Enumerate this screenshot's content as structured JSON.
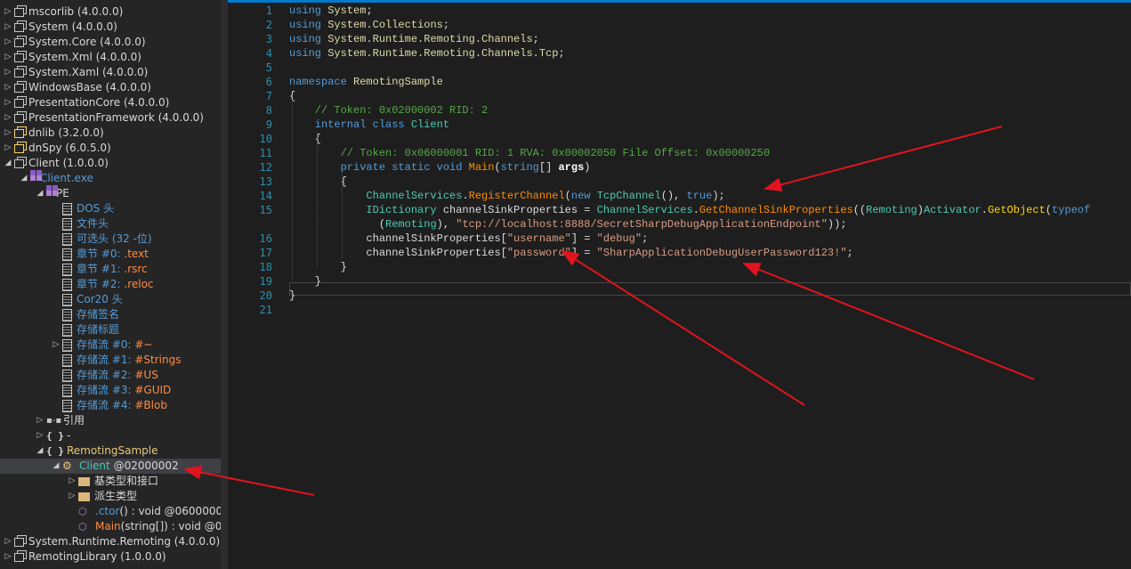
{
  "tree": {
    "nodes": [
      {
        "depth": 0,
        "tw": "▷",
        "icon": "asm",
        "name": "mscorlib",
        "extra": " (4.0.0.0)",
        "nc": "def"
      },
      {
        "depth": 0,
        "tw": "▷",
        "icon": "asm",
        "name": "System",
        "extra": " (4.0.0.0)",
        "nc": "def"
      },
      {
        "depth": 0,
        "tw": "▷",
        "icon": "asm",
        "name": "System.Core",
        "extra": " (4.0.0.0)",
        "nc": "def"
      },
      {
        "depth": 0,
        "tw": "▷",
        "icon": "asm",
        "name": "System.Xml",
        "extra": " (4.0.0.0)",
        "nc": "def"
      },
      {
        "depth": 0,
        "tw": "▷",
        "icon": "asm",
        "name": "System.Xaml",
        "extra": " (4.0.0.0)",
        "nc": "def"
      },
      {
        "depth": 0,
        "tw": "▷",
        "icon": "asm",
        "name": "WindowsBase",
        "extra": " (4.0.0.0)",
        "nc": "def"
      },
      {
        "depth": 0,
        "tw": "▷",
        "icon": "asm",
        "name": "PresentationCore",
        "extra": " (4.0.0.0)",
        "nc": "def"
      },
      {
        "depth": 0,
        "tw": "▷",
        "icon": "asm",
        "name": "PresentationFramework",
        "extra": " (4.0.0.0)",
        "nc": "def"
      },
      {
        "depth": 0,
        "tw": "▷",
        "icon": "asmj",
        "name": "dnlib",
        "extra": " (3.2.0.0)",
        "nc": "def"
      },
      {
        "depth": 0,
        "tw": "▷",
        "icon": "asmj",
        "name": "dnSpy",
        "extra": " (6.0.5.0)",
        "nc": "def"
      },
      {
        "depth": 0,
        "tw": "◢",
        "icon": "asm",
        "name": "Client",
        "extra": " (1.0.0.0)",
        "nc": "def"
      },
      {
        "depth": 1,
        "tw": "◢",
        "icon": "mod",
        "name": "Client.exe",
        "extra": "",
        "nc": "blue"
      },
      {
        "depth": 2,
        "tw": "◢",
        "icon": "mod",
        "name": "PE",
        "extra": "",
        "nc": "def"
      },
      {
        "depth": 3,
        "tw": "",
        "icon": "doc",
        "name": "DOS 头",
        "extra": "",
        "nc": "blue"
      },
      {
        "depth": 3,
        "tw": "",
        "icon": "doc",
        "name": "文件头",
        "extra": "",
        "nc": "blue"
      },
      {
        "depth": 3,
        "tw": "",
        "icon": "doc",
        "name": "可选头 (32 -位)",
        "extra": "",
        "nc": "blue"
      },
      {
        "depth": 3,
        "tw": "",
        "icon": "doc",
        "name": "章节 #0: ",
        "extra": ".text",
        "nc": "blue",
        "ec": "orange"
      },
      {
        "depth": 3,
        "tw": "",
        "icon": "doc",
        "name": "章节 #1: ",
        "extra": ".rsrc",
        "nc": "blue",
        "ec": "orange"
      },
      {
        "depth": 3,
        "tw": "",
        "icon": "doc",
        "name": "章节 #2: ",
        "extra": ".reloc",
        "nc": "blue",
        "ec": "orange"
      },
      {
        "depth": 3,
        "tw": "",
        "icon": "doc",
        "name": "Cor20 头",
        "extra": "",
        "nc": "blue"
      },
      {
        "depth": 3,
        "tw": "",
        "icon": "doc",
        "name": "存储签名",
        "extra": "",
        "nc": "blue"
      },
      {
        "depth": 3,
        "tw": "",
        "icon": "doc",
        "name": "存储标题",
        "extra": "",
        "nc": "blue"
      },
      {
        "depth": 3,
        "tw": "▷",
        "icon": "doc",
        "name": "存储流 #0: ",
        "extra": "#~",
        "nc": "blue",
        "ec": "orange"
      },
      {
        "depth": 3,
        "tw": "",
        "icon": "doc",
        "name": "存储流 #1: ",
        "extra": "#Strings",
        "nc": "blue",
        "ec": "orange"
      },
      {
        "depth": 3,
        "tw": "",
        "icon": "doc",
        "name": "存储流 #2: ",
        "extra": "#US",
        "nc": "blue",
        "ec": "orange"
      },
      {
        "depth": 3,
        "tw": "",
        "icon": "doc",
        "name": "存储流 #3: ",
        "extra": "#GUID",
        "nc": "blue",
        "ec": "orange"
      },
      {
        "depth": 3,
        "tw": "",
        "icon": "doc",
        "name": "存储流 #4: ",
        "extra": "#Blob",
        "nc": "blue",
        "ec": "orange"
      },
      {
        "depth": 2,
        "tw": "▷",
        "icon": "ref",
        "name": "引用",
        "extra": "",
        "nc": "def"
      },
      {
        "depth": 2,
        "tw": "▷",
        "icon": "ns",
        "name": "-",
        "extra": "",
        "nc": "def"
      },
      {
        "depth": 2,
        "tw": "◢",
        "icon": "ns",
        "name": "RemotingSample",
        "extra": "",
        "nc": "gold"
      },
      {
        "depth": 3,
        "tw": "◢",
        "icon": "cls",
        "name": "Client",
        "extra": " @02000002",
        "nc": "teal",
        "ec": "def",
        "sel": true
      },
      {
        "depth": 4,
        "tw": "▷",
        "icon": "fold",
        "name": "基类型和接口",
        "extra": "",
        "nc": "def"
      },
      {
        "depth": 4,
        "tw": "▷",
        "icon": "fold",
        "name": "派生类型",
        "extra": "",
        "nc": "def"
      },
      {
        "depth": 4,
        "tw": "",
        "icon": "mth",
        "name": ".ctor",
        "extra": "() : void @0600000",
        "nc": "blue",
        "ec": "def"
      },
      {
        "depth": 4,
        "tw": "",
        "icon": "mth",
        "name": "Main",
        "extra": "(string[]) : void @0",
        "nc": "orange",
        "ec": "def"
      },
      {
        "depth": 0,
        "tw": "▷",
        "icon": "asm",
        "name": "System.Runtime.Remoting",
        "extra": " (4.0.0.0)",
        "nc": "def"
      },
      {
        "depth": 0,
        "tw": "▷",
        "icon": "asm",
        "name": "RemotingLibrary",
        "extra": " (1.0.0.0)",
        "nc": "def"
      }
    ]
  },
  "editor": {
    "line_numbers": [
      "1",
      "2",
      "3",
      "4",
      "5",
      "6",
      "7",
      "8",
      "9",
      "10",
      "11",
      "12",
      "13",
      "14",
      "15",
      "",
      "16",
      "17",
      "18",
      "19",
      "20",
      "21"
    ],
    "lines": [
      [
        [
          "k",
          "using "
        ],
        [
          "nsn",
          "System"
        ],
        [
          "",
          "; "
        ]
      ],
      [
        [
          "k",
          "using "
        ],
        [
          "nsn",
          "System.Collections"
        ],
        [
          "",
          ";"
        ]
      ],
      [
        [
          "k",
          "using "
        ],
        [
          "nsn",
          "System.Runtime.Remoting.Channels"
        ],
        [
          "",
          ";"
        ]
      ],
      [
        [
          "k",
          "using "
        ],
        [
          "nsn",
          "System.Runtime.Remoting.Channels.Tcp"
        ],
        [
          "",
          ";"
        ]
      ],
      [],
      [
        [
          "k",
          "namespace "
        ],
        [
          "nsn",
          "RemotingSample"
        ]
      ],
      [
        [
          "",
          "{"
        ]
      ],
      [
        [
          "c",
          "    // Token: 0x02000002 RID: 2"
        ]
      ],
      [
        [
          "k",
          "    internal class "
        ],
        [
          "t",
          "Client"
        ]
      ],
      [
        [
          "",
          "    {"
        ]
      ],
      [
        [
          "c",
          "        // Token: 0x06000001 RID: 1 RVA: 0x00002050 File Offset: 0x00000250"
        ]
      ],
      [
        [
          "k",
          "        private static void "
        ],
        [
          "m",
          "Main"
        ],
        [
          "",
          "("
        ],
        [
          "k",
          "string"
        ],
        [
          "",
          "[] "
        ],
        [
          "b",
          "args"
        ],
        [
          "",
          ")"
        ]
      ],
      [
        [
          "",
          "        {"
        ]
      ],
      [
        [
          "t",
          "            ChannelServices"
        ],
        [
          "",
          "."
        ],
        [
          "m",
          "RegisterChannel"
        ],
        [
          "",
          "("
        ],
        [
          "k",
          "new "
        ],
        [
          "t",
          "TcpChannel"
        ],
        [
          "",
          "(), "
        ],
        [
          "k",
          "true"
        ],
        [
          "",
          ");"
        ]
      ],
      [
        [
          "t",
          "            IDictionary "
        ],
        [
          "",
          "channelSinkProperties = "
        ],
        [
          "t",
          "ChannelServices"
        ],
        [
          "",
          "."
        ],
        [
          "m",
          "GetChannelSinkProperties"
        ],
        [
          "",
          "(("
        ],
        [
          "t",
          "Remoting"
        ],
        [
          "",
          ")"
        ],
        [
          "t",
          "Activator"
        ],
        [
          "",
          "."
        ],
        [
          "y",
          "GetObject"
        ],
        [
          "",
          "("
        ],
        [
          "k",
          "typeof"
        ]
      ],
      [
        [
          "",
          "              ("
        ],
        [
          "t",
          "Remoting"
        ],
        [
          "",
          "), "
        ],
        [
          "s",
          "\"tcp://localhost:8888/SecretSharpDebugApplicationEndpoint\""
        ],
        [
          "",
          "));"
        ]
      ],
      [
        [
          "",
          "            channelSinkProperties["
        ],
        [
          "s",
          "\"username\""
        ],
        [
          "",
          "] = "
        ],
        [
          "s",
          "\"debug\""
        ],
        [
          "",
          ";"
        ]
      ],
      [
        [
          "",
          "            channelSinkProperties["
        ],
        [
          "s",
          "\"password\""
        ],
        [
          "",
          "] = "
        ],
        [
          "s",
          "\"SharpApplicationDebugUserPassword123!\""
        ],
        [
          "",
          ";"
        ]
      ],
      [
        [
          "",
          "        }"
        ]
      ],
      [
        [
          "",
          "    }"
        ]
      ],
      [
        [
          "",
          "}"
        ]
      ],
      []
    ]
  },
  "colors": {
    "accent": "#007acc",
    "annotation_arrow": "#e0141e"
  }
}
